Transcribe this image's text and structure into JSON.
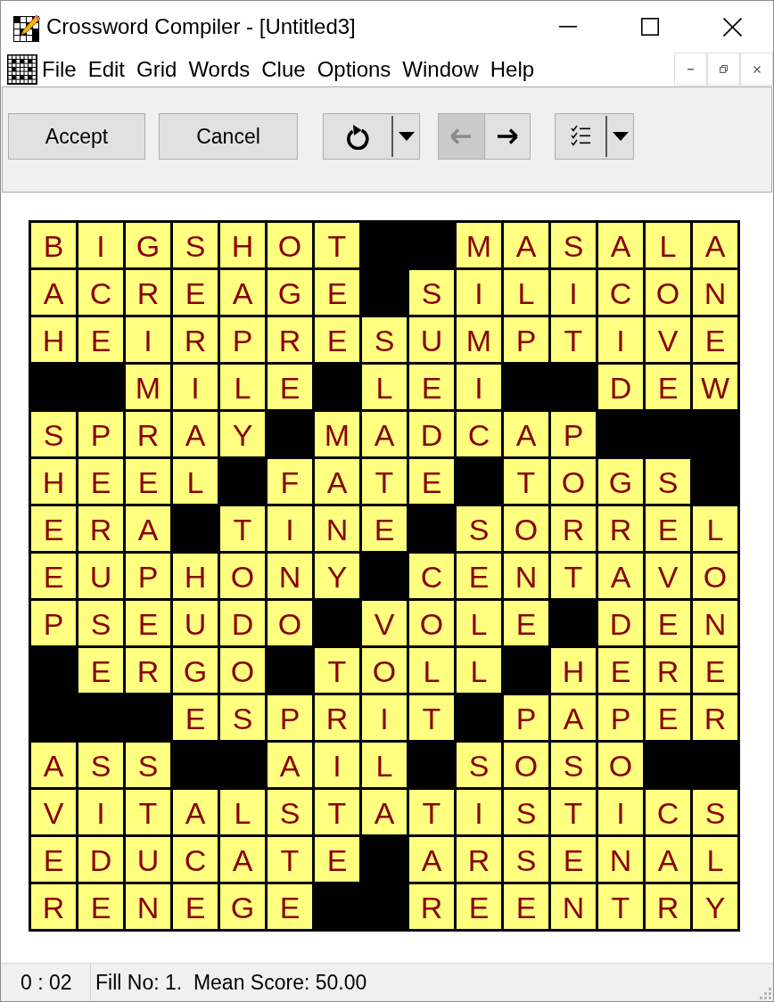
{
  "window": {
    "title": "Crossword Compiler - [Untitled3]"
  },
  "menu": [
    {
      "label": "File"
    },
    {
      "label": "Edit"
    },
    {
      "label": "Grid"
    },
    {
      "label": "Words"
    },
    {
      "label": "Clue"
    },
    {
      "label": "Options"
    },
    {
      "label": "Window"
    },
    {
      "label": "Help"
    }
  ],
  "toolbar": {
    "buttons": [
      {
        "label": "Accept"
      },
      {
        "label": "Cancel"
      }
    ],
    "history": [
      {
        "kind": "back",
        "disabled": true
      },
      {
        "kind": "forward",
        "disabled": false
      }
    ]
  },
  "grid": {
    "rows": [
      [
        "B",
        "I",
        "G",
        "S",
        "H",
        "O",
        "T",
        null,
        null,
        "M",
        "A",
        "S",
        "A",
        "L",
        "A"
      ],
      [
        "A",
        "C",
        "R",
        "E",
        "A",
        "G",
        "E",
        null,
        "S",
        "I",
        "L",
        "I",
        "C",
        "O",
        "N"
      ],
      [
        "H",
        "E",
        "I",
        "R",
        "P",
        "R",
        "E",
        "S",
        "U",
        "M",
        "P",
        "T",
        "I",
        "V",
        "E"
      ],
      [
        null,
        null,
        "M",
        "I",
        "L",
        "E",
        null,
        "L",
        "E",
        "I",
        null,
        null,
        "D",
        "E",
        "W"
      ],
      [
        "S",
        "P",
        "R",
        "A",
        "Y",
        null,
        "M",
        "A",
        "D",
        "C",
        "A",
        "P",
        null,
        null,
        null
      ],
      [
        "H",
        "E",
        "E",
        "L",
        null,
        "F",
        "A",
        "T",
        "E",
        null,
        "T",
        "O",
        "G",
        "S",
        null
      ],
      [
        "E",
        "R",
        "A",
        null,
        "T",
        "I",
        "N",
        "E",
        null,
        "S",
        "O",
        "R",
        "R",
        "E",
        "L"
      ],
      [
        "E",
        "U",
        "P",
        "H",
        "O",
        "N",
        "Y",
        null,
        "C",
        "E",
        "N",
        "T",
        "A",
        "V",
        "O"
      ],
      [
        "P",
        "S",
        "E",
        "U",
        "D",
        "O",
        null,
        "V",
        "O",
        "L",
        "E",
        null,
        "D",
        "E",
        "N"
      ],
      [
        null,
        "E",
        "R",
        "G",
        "O",
        null,
        "T",
        "O",
        "L",
        "L",
        null,
        "H",
        "E",
        "R",
        "E"
      ],
      [
        null,
        null,
        null,
        "E",
        "S",
        "P",
        "R",
        "I",
        "T",
        null,
        "P",
        "A",
        "P",
        "E",
        "R"
      ],
      [
        "A",
        "S",
        "S",
        null,
        null,
        "A",
        "I",
        "L",
        null,
        "S",
        "O",
        "S",
        "O",
        null,
        null
      ],
      [
        "V",
        "I",
        "T",
        "A",
        "L",
        "S",
        "T",
        "A",
        "T",
        "I",
        "S",
        "T",
        "I",
        "C",
        "S"
      ],
      [
        "E",
        "D",
        "U",
        "C",
        "A",
        "T",
        "E",
        null,
        "A",
        "R",
        "S",
        "E",
        "N",
        "A",
        "L"
      ],
      [
        "R",
        "E",
        "N",
        "E",
        "G",
        "E",
        null,
        null,
        "R",
        "E",
        "E",
        "N",
        "T",
        "R",
        "Y"
      ]
    ]
  },
  "status_bar": {
    "time": "0 : 02",
    "message": "Fill No: 1.  Mean Score: 50.00"
  }
}
